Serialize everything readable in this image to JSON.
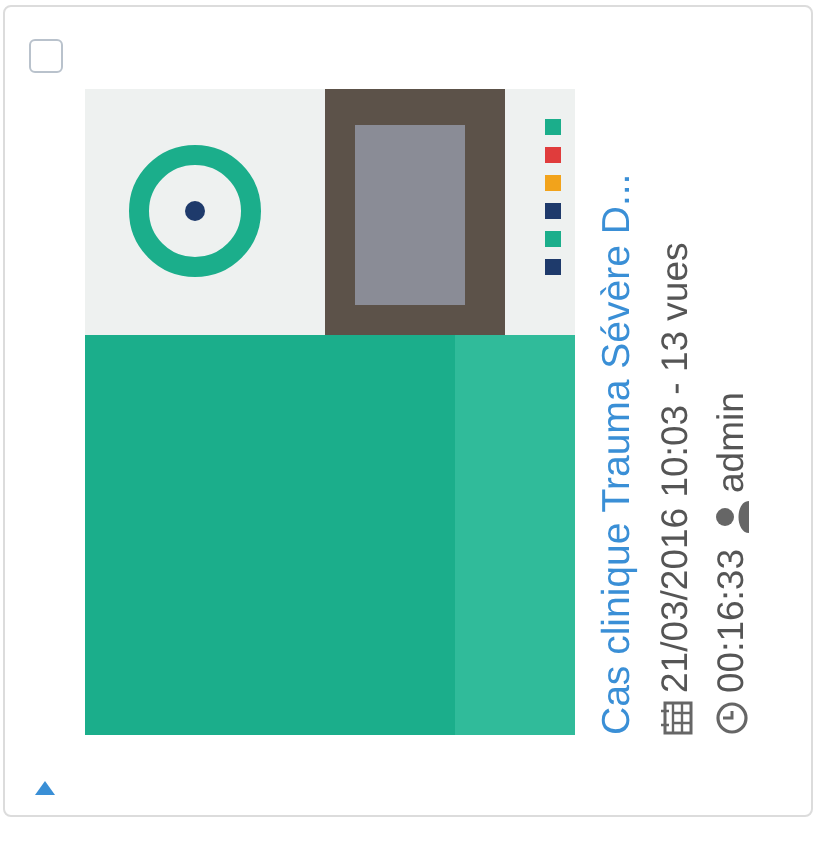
{
  "card": {
    "checked": false,
    "title": "Cas clinique Trauma Sévère D...",
    "date": "21/03/2016 10:03 - 13 vues",
    "duration": "00:16:33",
    "author": "admin"
  }
}
